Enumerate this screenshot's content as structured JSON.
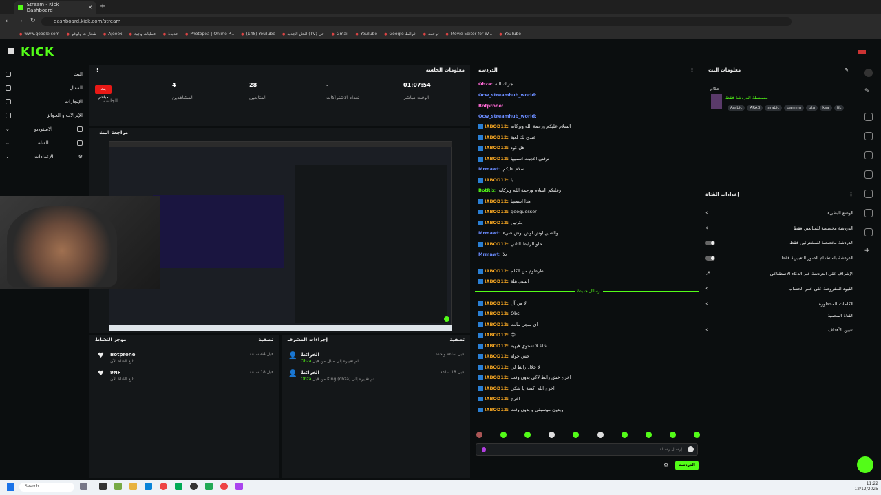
{
  "browser": {
    "tab_title": "Stream - Kick Dashboard",
    "url": "dashboard.kick.com/stream",
    "bookmarks": [
      "www.google.com",
      "شعارات ولوغو",
      "Ajeeex",
      "عمليات وجبة",
      "حديدة",
      "Photopea | Online P...",
      "(148) YouTube",
      "الحل الجديد (TV) جي",
      "Gmail",
      "YouTube",
      "Google خرائط",
      "ترجمة",
      "Movie Editor for W...",
      "YouTube"
    ]
  },
  "app": {
    "logo": "KICK"
  },
  "nav": {
    "items": [
      {
        "label": "البث"
      },
      {
        "label": "المقال"
      },
      {
        "label": "الإنجازات"
      },
      {
        "label": "الإنزالات و الجوائز"
      },
      {
        "label": "الاستوديو"
      },
      {
        "label": "القناة"
      },
      {
        "label": "الإعدادات"
      }
    ]
  },
  "session": {
    "title": "معلومات الجلسة",
    "live_badge": "بث مباشر",
    "live_label": "الجلسة",
    "stats": [
      {
        "value": "4",
        "label": "المشاهدين"
      },
      {
        "value": "28",
        "label": "المتابعين"
      },
      {
        "value": "-",
        "label": "تعداد الاشتراكات"
      },
      {
        "value": "01:07:54",
        "label": "الوقت مباشر"
      }
    ]
  },
  "preview": {
    "title": "مراجعة البث"
  },
  "activity": {
    "title": "موجز النشاط",
    "filter": "تصفية",
    "items": [
      {
        "user": "Botprone",
        "desc": "تابع القناة الآن",
        "time": "قبل 44 ساعة"
      },
      {
        "user": "9NF",
        "desc": "تابع القناة الآن",
        "time": "قبل 18 ساعة"
      }
    ]
  },
  "moderation": {
    "title": "إجراءات المشرف",
    "filter": "تصفية",
    "items": [
      {
        "title": "الخرائط",
        "desc": "لم تغييره إلى مبال من قبل",
        "user": "Obza",
        "time": "قبل ساعة واحدة"
      },
      {
        "title": "الخرائط",
        "desc": "تم تغييره إلى King (obza) من قبل",
        "user": "Obza",
        "time": "قبل 18 ساعة"
      }
    ]
  },
  "chat": {
    "title": "الدردشة",
    "new_messages": "رسائل جديدة",
    "input_placeholder": "إرسال رسالة...",
    "send_label": "الدردشة",
    "messages": [
      {
        "user": "Obza:",
        "text": "جزاك الله",
        "cls": "p"
      },
      {
        "user": "Ocw_streamhub_world:",
        "text": "",
        "cls": "b"
      },
      {
        "user": "Botprone:",
        "text": "",
        "cls": "p"
      },
      {
        "user": "Ocw_streamhub_world:",
        "text": "",
        "cls": "b"
      },
      {
        "user": "IABOD12:",
        "text": "السلام عليكم ورحمة الله وبركاته",
        "cls": ""
      },
      {
        "user": "IABOD12:",
        "text": "عندي لك لعبة",
        "cls": ""
      },
      {
        "user": "IABOD12:",
        "text": "هل كود",
        "cls": ""
      },
      {
        "user": "IABOD12:",
        "text": "ترقني اعجبت اسميها",
        "cls": ""
      },
      {
        "user": "Mrmawt:",
        "text": "سلام عليكم",
        "cls": "b"
      },
      {
        "user": "IABOD12:",
        "text": "يا",
        "cls": ""
      },
      {
        "user": "BotRix:",
        "text": "وعليكم السلام ورحمة الله وبركاته",
        "cls": "g"
      },
      {
        "user": "IABOD12:",
        "text": "هذا اسميها",
        "cls": ""
      },
      {
        "user": "IABOD12:",
        "text": "geoguesser",
        "cls": ""
      },
      {
        "user": "IABOD12:",
        "text": "بكرتين",
        "cls": ""
      },
      {
        "user": "Mrmawt:",
        "text": "والشين اوش اوش اوش شيء",
        "cls": "b"
      },
      {
        "user": "IABOD12:",
        "text": "حلو الرابط الثاني",
        "cls": ""
      },
      {
        "user": "Mrmawt:",
        "text": "يلا",
        "cls": "b"
      },
      {
        "user": "IABOD12:",
        "text": "اطرطوم من الكلم",
        "cls": ""
      },
      {
        "user": "IABOD12:",
        "text": "البيتي هلة",
        "cls": ""
      },
      {
        "user": "IABOD12:",
        "text": "لا من آل",
        "cls": ""
      },
      {
        "user": "IABOD12:",
        "text": "Obs",
        "cls": ""
      },
      {
        "user": "IABOD12:",
        "text": "اي سجل مانت",
        "cls": ""
      },
      {
        "user": "IABOD12:",
        "text": "😊",
        "cls": ""
      },
      {
        "user": "IABOD12:",
        "text": "شلة لا تستوي هيهيه",
        "cls": ""
      },
      {
        "user": "IABOD12:",
        "text": "خش جولة",
        "cls": ""
      },
      {
        "user": "IABOD12:",
        "text": "لا خلال رابط لي",
        "cls": ""
      },
      {
        "user": "IABOD12:",
        "text": "اخرج خش رابط لاكي بدون وقت",
        "cls": ""
      },
      {
        "user": "IABOD12:",
        "text": "اخرج الله اكسة يا شكي",
        "cls": ""
      },
      {
        "user": "IABOD12:",
        "text": "اخرج",
        "cls": ""
      },
      {
        "user": "IABOD12:",
        "text": "وبدون موسيقى و بدون وقت",
        "cls": ""
      }
    ]
  },
  "stream_info": {
    "title": "معلومات البث",
    "stream_name": "مسلسلة الدردشة فقط",
    "category": "حكام",
    "tags": [
      "Arabic",
      "ARAB",
      "arabic",
      "gaming",
      "gta",
      "ksa",
      "tik"
    ]
  },
  "chat_settings": {
    "title": "إعدادات القناة",
    "rows": [
      {
        "label": "الوضع البطيء",
        "control": "chev"
      },
      {
        "label": "الدردشة مخصصة للمتابعين فقط",
        "control": "chev"
      },
      {
        "label": "الدردشة مخصصة للمشتركين فقط",
        "control": "toggle"
      },
      {
        "label": "الدردشة باستخدام الصور التعبيرية فقط",
        "control": "toggle"
      },
      {
        "label": "الإشراف على الدردشة عبر الذكاء الاصطناعي",
        "control": "link"
      },
      {
        "label": "القيود المفروضة على عمر الحساب",
        "control": "chev"
      },
      {
        "label": "الكلمات المحظورة",
        "control": "chev"
      },
      {
        "label": "القناة المحمية",
        "control": "none"
      },
      {
        "label": "تعيين الأهداف",
        "control": "chev"
      }
    ]
  },
  "taskbar": {
    "search": "Search",
    "time": "11:22",
    "date": "12/12/2025"
  }
}
